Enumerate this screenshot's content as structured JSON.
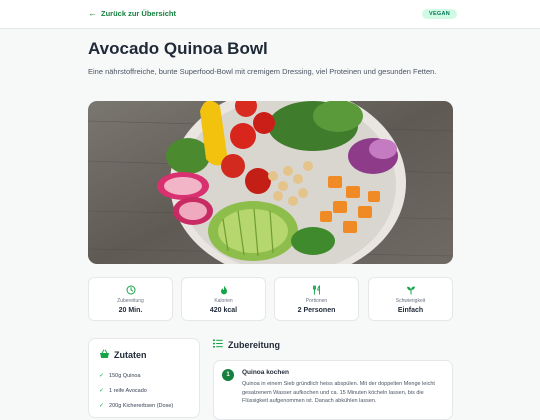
{
  "nav": {
    "back_label": "Zurück zur Übersicht",
    "badge": "VEGAN"
  },
  "recipe": {
    "title": "Avocado Quinoa Bowl",
    "description": "Eine nährstoffreiche, bunte Superfood-Bowl mit cremigem Dressing, viel Proteinen und gesunden Fetten."
  },
  "stats": [
    {
      "icon": "clock-icon",
      "label": "Zubereitung",
      "value": "20 Min."
    },
    {
      "icon": "flame-icon",
      "label": "Kalorien",
      "value": "420 kcal"
    },
    {
      "icon": "cutlery-icon",
      "label": "Portionen",
      "value": "2 Personen"
    },
    {
      "icon": "sprout-icon",
      "label": "Schwierigkeit",
      "value": "Einfach"
    }
  ],
  "ingredients": {
    "title": "Zutaten",
    "items": [
      "150g Quinoa",
      "1 reife Avocado",
      "200g Kichererbsen (Dose)"
    ]
  },
  "steps": {
    "title": "Zubereitung",
    "items": [
      {
        "number": "1",
        "title": "Quinoa kochen",
        "text": "Quinoa in einem Sieb gründlich heiss abspülen. Mit der doppelten Menge leicht gesalzenem Wasser aufkochen und ca. 15 Minuten köcheln lassen, bis die Flüssigkeit aufgenommen ist. Danach abkühlen lassen."
      }
    ]
  },
  "colors": {
    "accent": "#15803d",
    "badge_bg": "#d1fae5",
    "page_bg": "#f7f8f8"
  }
}
